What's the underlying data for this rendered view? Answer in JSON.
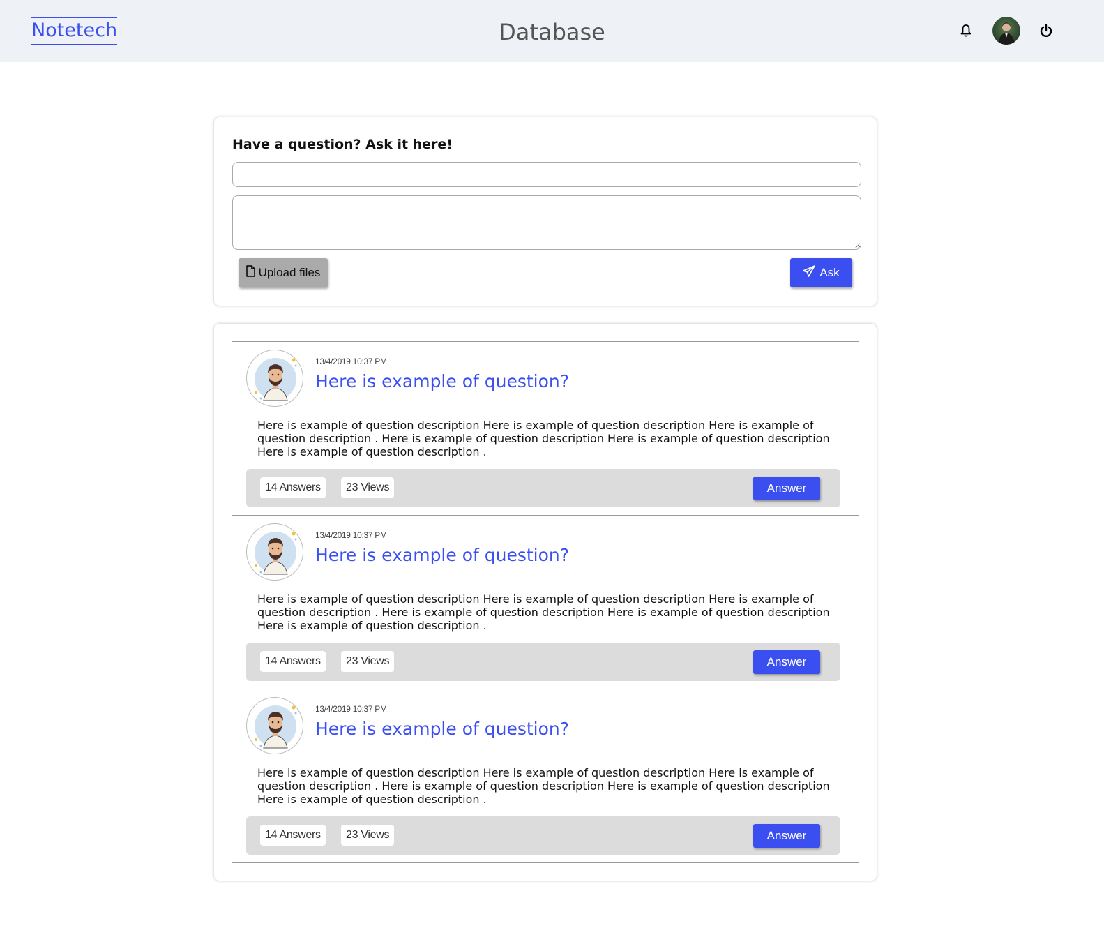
{
  "header": {
    "brand": "Notetech",
    "title": "Database"
  },
  "ask": {
    "label": "Have a question? Ask it here!",
    "title_value": "",
    "description_value": "",
    "upload_label": "Upload files",
    "ask_label": "Ask"
  },
  "questions": [
    {
      "date": "13/4/2019 10:37 PM",
      "title": "Here is example of question?",
      "description": "Here is example of question description Here is example of question description Here is example of question description . Here is example of question description Here is example of question description Here is example of question description .",
      "answers": "14 Answers",
      "views": "23 Views",
      "answer_label": "Answer"
    },
    {
      "date": "13/4/2019 10:37 PM",
      "title": "Here is example of question?",
      "description": "Here is example of question description Here is example of question description Here is example of question description . Here is example of question description Here is example of question description Here is example of question description .",
      "answers": "14 Answers",
      "views": "23 Views",
      "answer_label": "Answer"
    },
    {
      "date": "13/4/2019 10:37 PM",
      "title": "Here is example of question?",
      "description": "Here is example of question description Here is example of question description Here is example of question description . Here is example of question description Here is example of question description Here is example of question description .",
      "answers": "14 Answers",
      "views": "23 Views",
      "answer_label": "Answer"
    }
  ],
  "icons": {
    "notifications": "bell-icon",
    "logout": "power-icon",
    "upload": "file-icon",
    "ask": "paper-plane-icon"
  },
  "colors": {
    "accent": "#3b4ff0",
    "header_bg": "#eef2f6",
    "footer_bg": "#dcdcdc",
    "upload_bg": "#aaaaaa"
  }
}
